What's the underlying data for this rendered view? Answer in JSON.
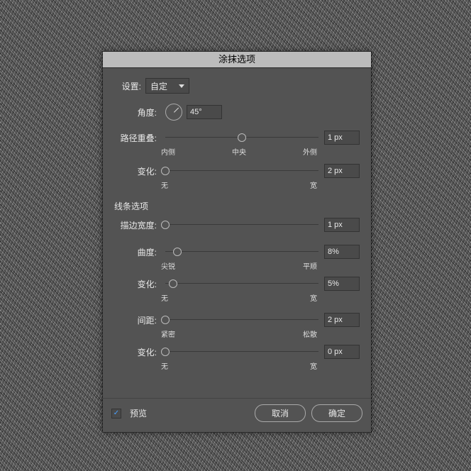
{
  "title": "涂抹选项",
  "settings_label": "设置:",
  "settings_value": "自定",
  "angle": {
    "label": "角度:",
    "value": "45°"
  },
  "path_overlap": {
    "label": "路径重叠:",
    "value": "1 px",
    "ticks": {
      "left": "内侧",
      "mid": "中央",
      "right": "外侧"
    },
    "pos": 50
  },
  "path_var": {
    "label": "变化:",
    "value": "2 px",
    "ticks": {
      "left": "无",
      "right": "宽"
    },
    "pos": 0
  },
  "lines_section": "线条选项",
  "stroke_width": {
    "label": "描边宽度:",
    "value": "1 px",
    "pos": 0
  },
  "curv": {
    "label": "曲度:",
    "value": "8%",
    "ticks": {
      "left": "尖锐",
      "right": "平顺"
    },
    "pos": 8
  },
  "curv_var": {
    "label": "变化:",
    "value": "5%",
    "ticks": {
      "left": "无",
      "right": "宽"
    },
    "pos": 5
  },
  "spacing": {
    "label": "间距:",
    "value": "2 px",
    "ticks": {
      "left": "紧密",
      "right": "松散"
    },
    "pos": 0
  },
  "spacing_var": {
    "label": "变化:",
    "value": "0 px",
    "ticks": {
      "left": "无",
      "right": "宽"
    },
    "pos": 0
  },
  "preview_label": "预览",
  "cancel": "取消",
  "ok": "确定"
}
